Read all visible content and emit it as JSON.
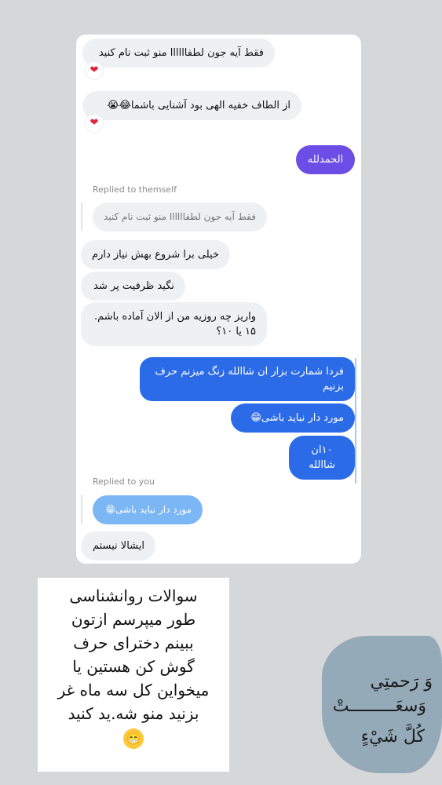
{
  "messages": {
    "m1": "فقط آیه جون لطفاااااا منو ثبت نام کنید",
    "m2": "از الطاف خفیه الهی بود آشنایی باشما😂😭",
    "m3": "الحمدلله",
    "reply1_label": "Replied to themself",
    "reply1_quote": "فقط آیه جون لطفاااااا منو ثبت نام کنید",
    "m4": "خیلی برا شروع بهش نیاز دارم",
    "m5": "نگید ظرفیت پر شد",
    "m6_line1": "واریز چه روزیه من از الان آماده باشم.",
    "m6_line2": "۱۵ یا ۱۰؟",
    "m7": "فردا شمارت بزار ان شاالله زنگ میزنم حرف بزنیم",
    "m8": "مورد دار نباید باشی😁",
    "m9": "۱۰ان شاالله",
    "reply2_label": "Replied to you",
    "reply2_quote": "مورد دار نباید باشی😁",
    "m10": "ایشالا نیستم",
    "reaction": "❤"
  },
  "note": {
    "lines": [
      "سوالات روانشناسی",
      "طور میپرسم ازتون",
      "ببینم دختراى حرف",
      "گوش کن هستین یا",
      "میخواین کل سه ماه غر",
      "بزنید منو شه.ید کنید"
    ],
    "emoji": "😁"
  },
  "sticker": {
    "line1": "وَ رَحمتِي",
    "line2": "وَسعَـــــــــتْ",
    "line3": "كُلَّ شَيْءٍ"
  },
  "colors": {
    "background": "#d6d7d9",
    "purple_bubble": "#6c4de6",
    "blue_bubble": "#2b6be8",
    "quoted_blue": "#7bb6f5",
    "incoming_bubble": "#eff0f2"
  }
}
